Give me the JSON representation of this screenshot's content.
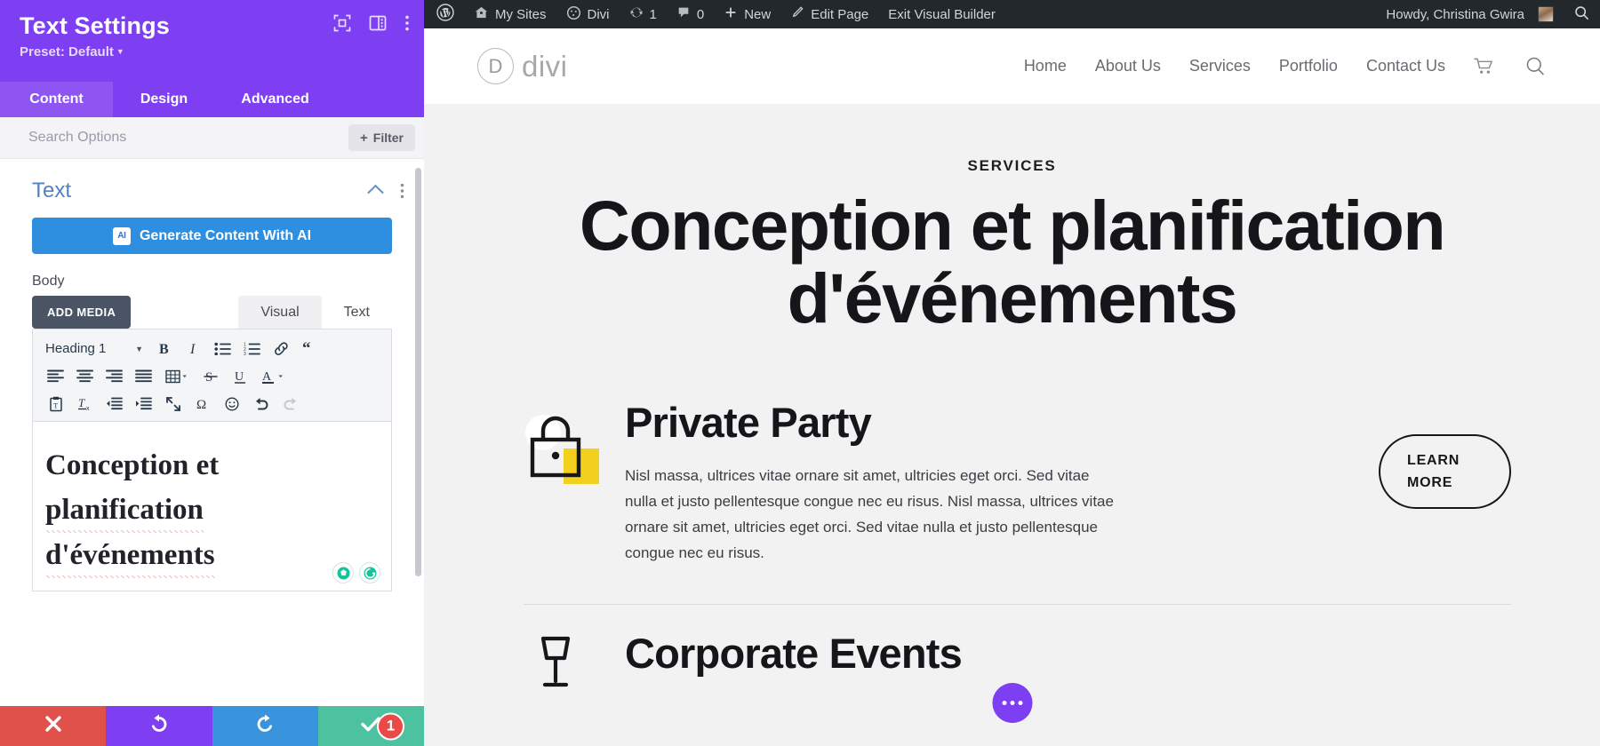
{
  "settings_panel": {
    "title": "Text Settings",
    "preset": "Preset: Default",
    "header_icons": [
      {
        "name": "focus-icon"
      },
      {
        "name": "layout-columns-icon"
      },
      {
        "name": "more-vertical-icon"
      }
    ],
    "tabs": [
      {
        "label": "Content",
        "active": true
      },
      {
        "label": "Design",
        "active": false
      },
      {
        "label": "Advanced",
        "active": false
      }
    ],
    "search": {
      "placeholder": "Search Options",
      "value": "",
      "filter_label": "Filter",
      "filter_plus": "+"
    },
    "section": {
      "title": "Text",
      "ai_button": {
        "label": "Generate Content With AI",
        "badge": "AI"
      },
      "body_label": "Body",
      "add_media": "ADD MEDIA",
      "editor_tabs": [
        {
          "label": "Visual",
          "active": true
        },
        {
          "label": "Text",
          "active": false
        }
      ],
      "format_select": "Heading 1",
      "toolbar_row1": [
        {
          "name": "bold-icon",
          "glyph": "B"
        },
        {
          "name": "italic-icon",
          "glyph": "I"
        },
        {
          "name": "bulleted-list-icon",
          "glyph": ""
        },
        {
          "name": "numbered-list-icon",
          "glyph": ""
        },
        {
          "name": "link-icon",
          "glyph": ""
        },
        {
          "name": "blockquote-icon",
          "glyph": "“"
        }
      ],
      "toolbar_row2": [
        {
          "name": "align-left-icon"
        },
        {
          "name": "align-center-icon"
        },
        {
          "name": "align-right-icon"
        },
        {
          "name": "align-justify-icon"
        },
        {
          "name": "table-icon"
        },
        {
          "name": "strikethrough-icon",
          "glyph": "S"
        },
        {
          "name": "underline-icon",
          "glyph": "U"
        },
        {
          "name": "text-color-icon",
          "glyph": "A"
        }
      ],
      "toolbar_row3": [
        {
          "name": "paste-as-text-icon"
        },
        {
          "name": "clear-formatting-icon"
        },
        {
          "name": "outdent-icon"
        },
        {
          "name": "indent-icon"
        },
        {
          "name": "fullscreen-icon"
        },
        {
          "name": "special-character-icon",
          "glyph": "Ω"
        },
        {
          "name": "emoji-icon",
          "glyph": "☺"
        },
        {
          "name": "undo-icon"
        },
        {
          "name": "redo-icon"
        }
      ],
      "editor_content": {
        "line1": "Conception et",
        "line2": "planification",
        "line3": "d'événements"
      },
      "grammar_badges": [
        {
          "name": "grammarly-premium-badge"
        },
        {
          "name": "grammarly-check-badge"
        }
      ]
    },
    "actions": [
      {
        "name": "cancel-button",
        "icon": "close-icon",
        "color": "#e0514b"
      },
      {
        "name": "undo-button",
        "icon": "undo-icon",
        "color": "#7d3ff1"
      },
      {
        "name": "redo-button",
        "icon": "redo-icon",
        "color": "#3a93dd"
      },
      {
        "name": "save-button",
        "icon": "check-icon",
        "color": "#4cc2a0",
        "badge": "1"
      }
    ]
  },
  "admin_bar": {
    "items": [
      {
        "name": "wordpress-logo-icon",
        "label": ""
      },
      {
        "name": "my-sites",
        "label": "My Sites"
      },
      {
        "name": "divi-menu",
        "label": "Divi"
      },
      {
        "name": "updates",
        "label": "1"
      },
      {
        "name": "comments",
        "label": "0"
      },
      {
        "name": "new-content",
        "label": "New"
      },
      {
        "name": "edit-page",
        "label": "Edit Page"
      },
      {
        "name": "exit-visual-builder",
        "label": "Exit Visual Builder"
      }
    ],
    "howdy": "Howdy, Christina Gwira",
    "search_icon": "search-icon"
  },
  "site_header": {
    "logo_mark": "D",
    "logo_word": "divi",
    "nav": [
      {
        "label": "Home"
      },
      {
        "label": "About Us"
      },
      {
        "label": "Services"
      },
      {
        "label": "Portfolio"
      },
      {
        "label": "Contact Us"
      }
    ],
    "cart_icon": "shopping-cart-icon",
    "search_icon": "search-icon"
  },
  "page": {
    "eyebrow": "SERVICES",
    "hero_line1": "Conception et planification",
    "hero_line2": "d'événements",
    "services": [
      {
        "icon": "lock-icon",
        "heading": "Private Party",
        "body": "Nisl massa, ultrices vitae ornare sit amet, ultricies eget orci. Sed vitae nulla et justo pellentesque congue nec eu risus. Nisl massa, ultrices vitae ornare sit amet, ultricies eget orci. Sed vitae nulla et justo pellentesque congue nec eu risus.",
        "cta_line1": "LEARN",
        "cta_line2": "MORE"
      },
      {
        "icon": "drink-glass-icon",
        "heading": "Corporate Events",
        "body": "",
        "cta_line1": "",
        "cta_line2": ""
      }
    ],
    "fab": "add-module-fab"
  },
  "colors": {
    "divi_purple": "#7d3ff1",
    "divi_purple_light": "#8e55f3",
    "ai_blue": "#2e8fe0",
    "cancel_red": "#e0514b",
    "redo_blue": "#3a93dd",
    "save_green": "#4cc2a0",
    "admin_dark": "#23282d",
    "accent_yellow": "#f2d01e"
  }
}
